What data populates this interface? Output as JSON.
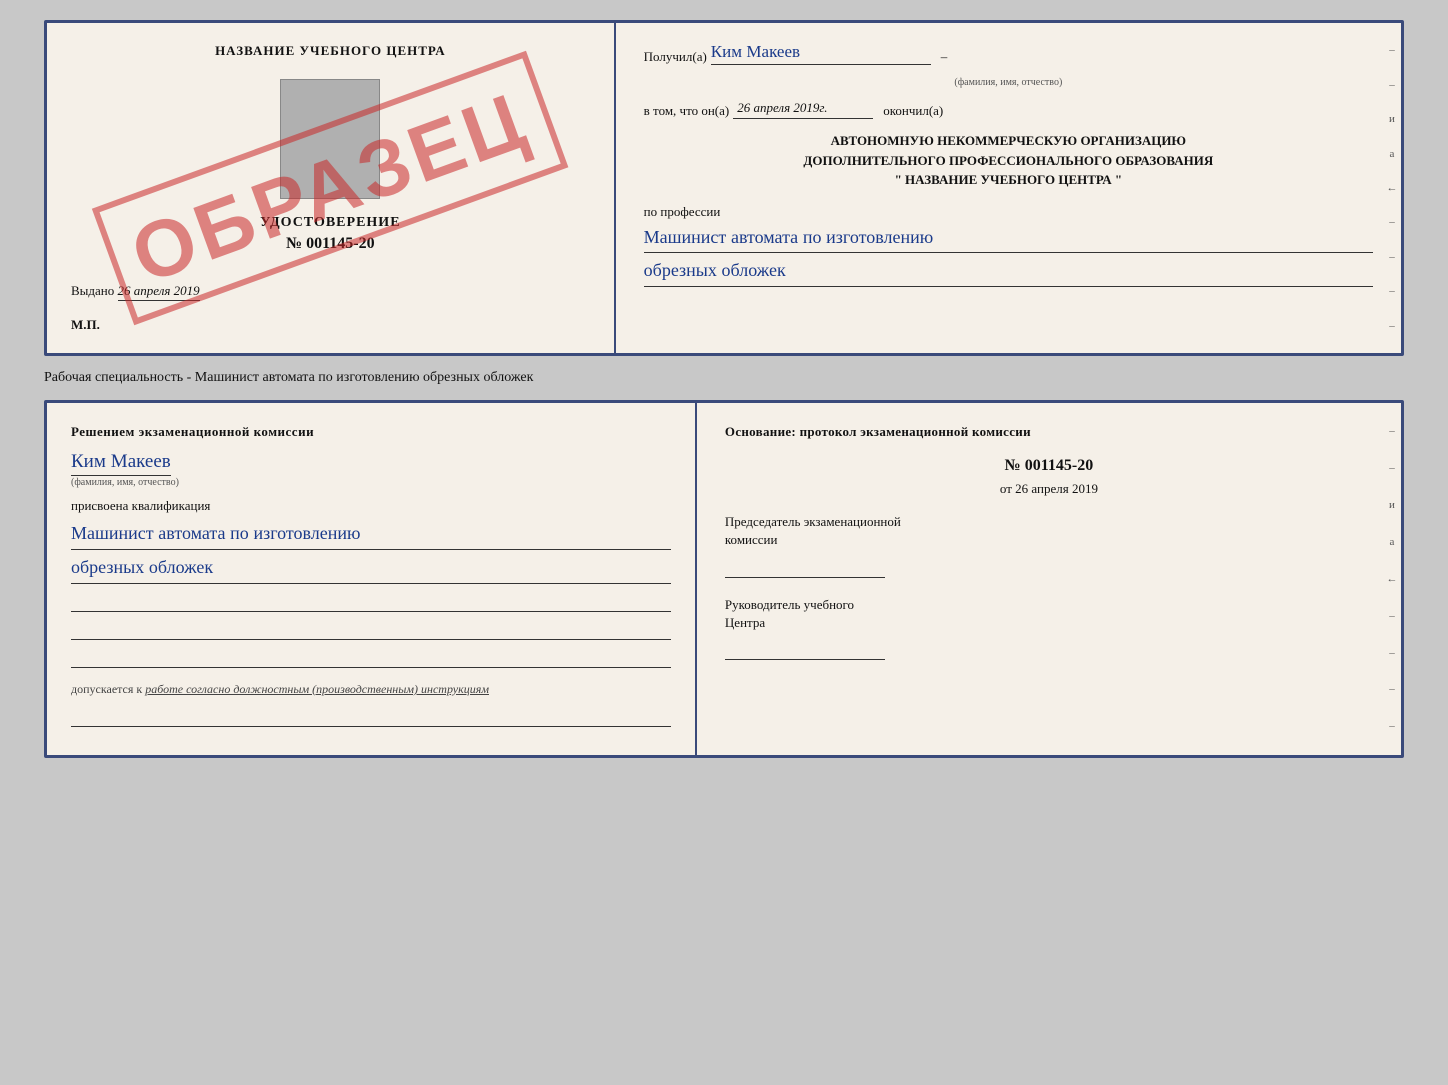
{
  "top_cert": {
    "left": {
      "title": "НАЗВАНИЕ УЧЕБНОГО ЦЕНТРА",
      "watermark": "ОБРАЗЕЦ",
      "udostoverenie": "УДОСТОВЕРЕНИЕ",
      "number": "№ 001145-20",
      "vydano_label": "Выдано",
      "vydano_date": "26 апреля 2019",
      "mp": "М.П."
    },
    "right": {
      "poluchil_label": "Получил(a)",
      "recipient_name": "Ким Макеев",
      "fio_label": "(фамилия, имя, отчество)",
      "vtom_label": "в том, что он(а)",
      "vtom_date": "26 апреля 2019г.",
      "okonchill_label": "окончил(a)",
      "org_line1": "АВТОНОМНУЮ НЕКОММЕРЧЕСКУЮ ОРГАНИЗАЦИЮ",
      "org_line2": "ДОПОЛНИТЕЛЬНОГО ПРОФЕССИОНАЛЬНОГО ОБРАЗОВАНИЯ",
      "org_line3": "\" НАЗВАНИЕ УЧЕБНОГО ЦЕНТРА \"",
      "po_professii": "по профессии",
      "profession_line1": "Машинист автомата по изготовлению",
      "profession_line2": "обрезных обложек",
      "sidebar_items": [
        "-",
        "-",
        "и",
        "а",
        "←",
        "-",
        "-",
        "-",
        "-"
      ]
    }
  },
  "specialty_label": "Рабочая специальность - Машинист автомата по изготовлению обрезных обложек",
  "bottom_cert": {
    "left": {
      "title_line1": "Решением экзаменационной комиссии",
      "recipient_name": "Ким Макеев",
      "fio_label": "(фамилия, имя, отчество)",
      "prisvoena": "присвоена квалификация",
      "qualification_line1": "Машинист автомата по изготовлению",
      "qualification_line2": "обрезных обложек",
      "dopuskaetsya": "допускается к",
      "dopuskaetsya_text": "работе согласно должностным (производственным) инструкциям"
    },
    "right": {
      "osnovanie": "Основание: протокол экзаменационной комиссии",
      "number": "№ 001145-20",
      "ot_label": "от",
      "date": "26 апреля 2019",
      "chairman_title": "Председатель экзаменационной",
      "chairman_title2": "комиссии",
      "rukovoditel_title": "Руководитель учебного",
      "rukovoditel_title2": "Центра",
      "sidebar_items": [
        "-",
        "-",
        "и",
        "а",
        "←",
        "-",
        "-",
        "-",
        "-"
      ]
    }
  }
}
